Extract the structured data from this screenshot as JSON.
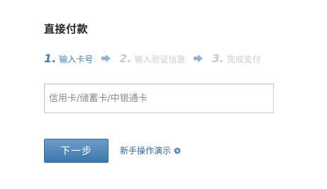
{
  "page": {
    "title": "直接付款"
  },
  "steps": [
    {
      "number": "1.",
      "label": "输入卡号",
      "state": "active"
    },
    {
      "number": "2.",
      "label": "输入验证信息",
      "state": "inactive"
    },
    {
      "number": "3.",
      "label": "完成支付",
      "state": "inactive"
    }
  ],
  "card_input": {
    "value": "",
    "placeholder": "信用卡/储蓄卡/中银通卡"
  },
  "actions": {
    "next_label": "下一步",
    "demo_label": "新手操作演示"
  },
  "icons": {
    "step_arrow": "arrow-right-icon",
    "demo": "play-circle-icon"
  },
  "colors": {
    "active_step": "#3f7fb7",
    "inactive_step": "#c3ccd6",
    "button": "#3b77ad",
    "link": "#2d6aa3"
  }
}
